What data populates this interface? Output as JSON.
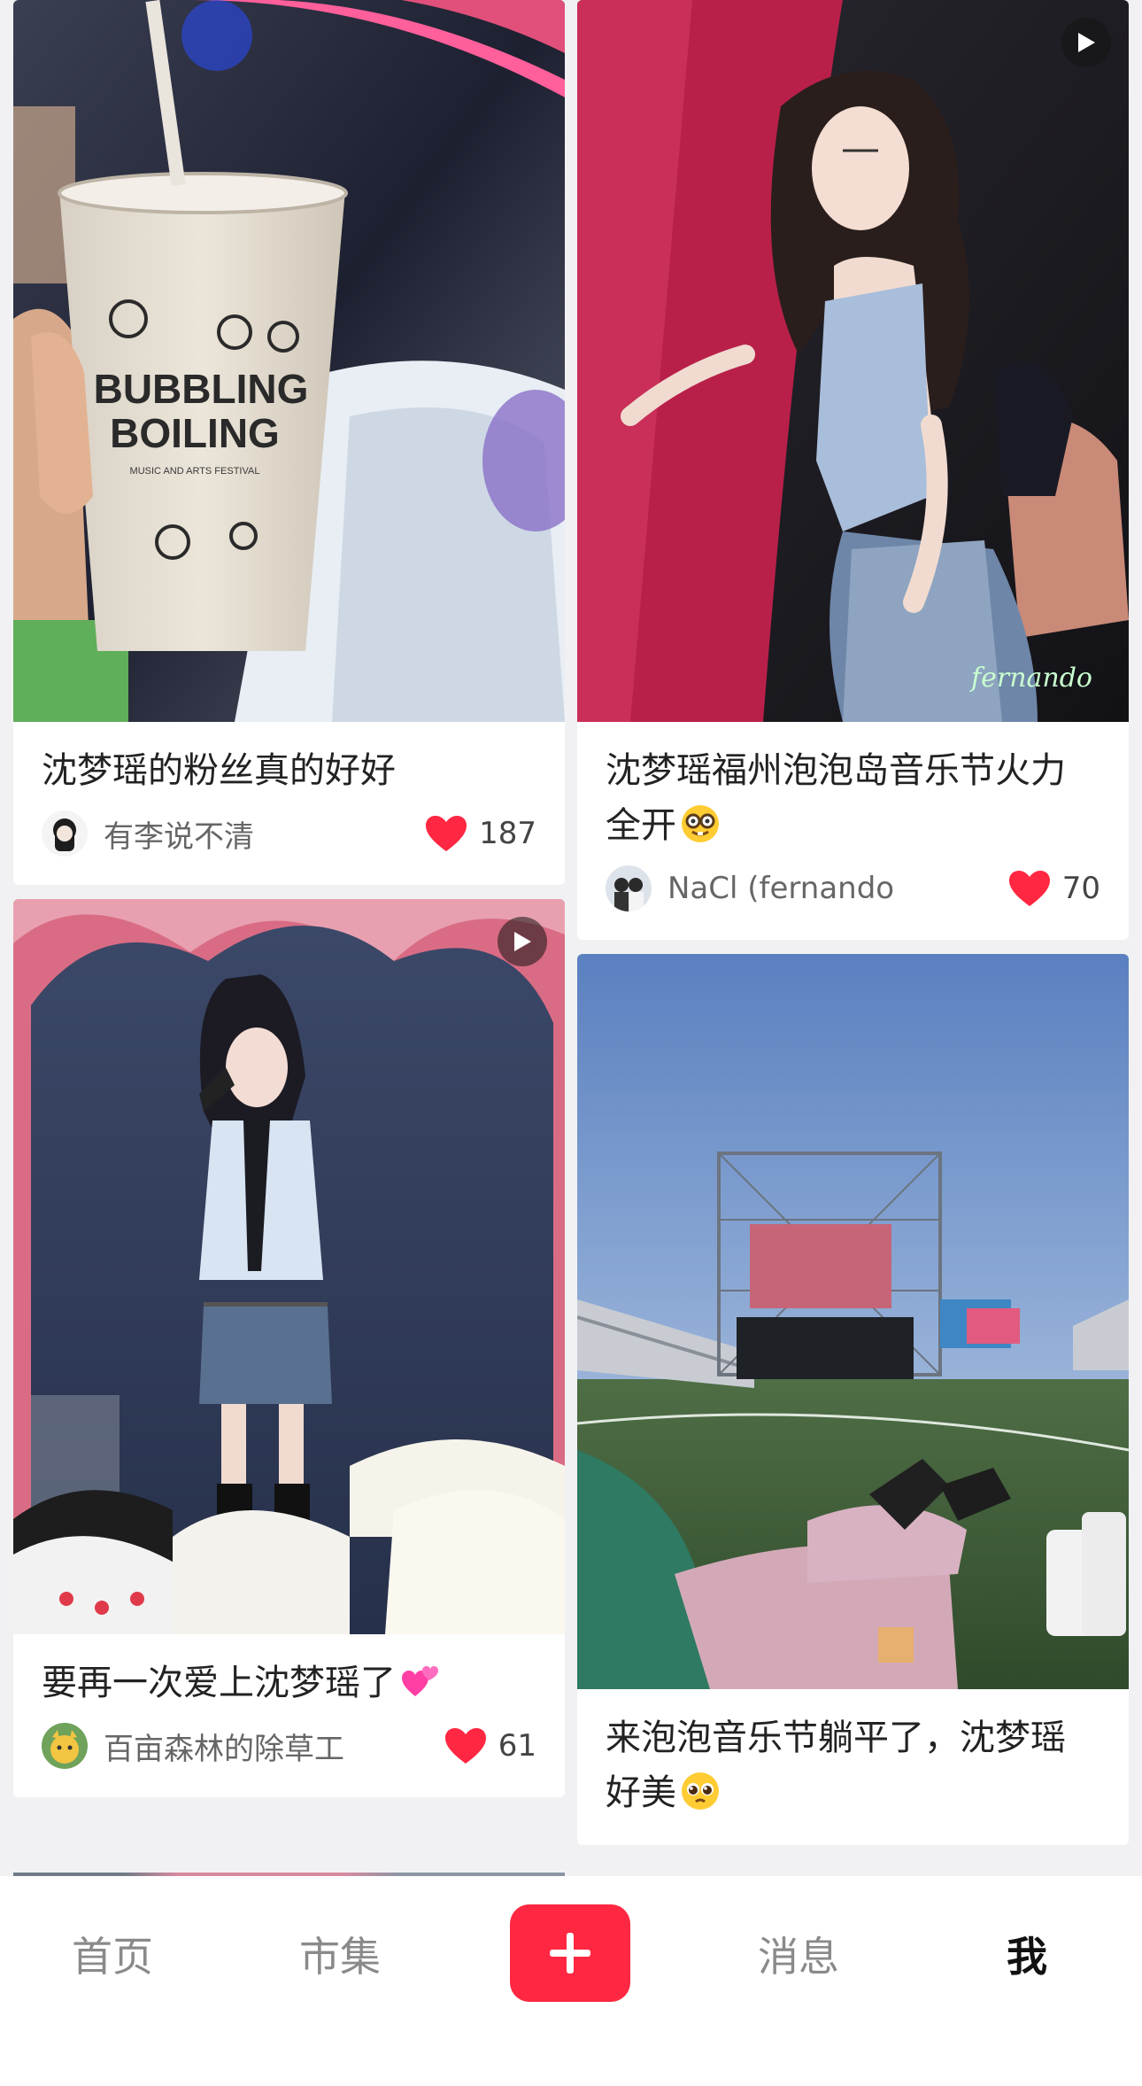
{
  "feed": {
    "left": [
      {
        "title": "沈梦瑶的粉丝真的好好",
        "author": "有李说不清",
        "likes": "187",
        "is_video": false,
        "image_text": [
          "BUBBLING",
          "BOILING",
          "MUSIC AND ARTS FESTIVAL"
        ]
      },
      {
        "title": "要再一次爱上沈梦瑶了",
        "title_emoji": "two-hearts",
        "author": "百亩森林的除草工",
        "likes": "61",
        "is_video": true
      }
    ],
    "right": [
      {
        "title": "沈梦瑶福州泡泡岛音乐节火力全开",
        "title_emoji": "nerd-face",
        "author": "NaCl (fernando",
        "likes": "70",
        "is_video": true,
        "watermark": "fernando"
      },
      {
        "title": "来泡泡音乐节躺平了，沈梦瑶好美",
        "title_emoji": "pleading-face",
        "is_video": false
      }
    ]
  },
  "tabbar": {
    "home": "首页",
    "market": "市集",
    "messages": "消息",
    "me": "我",
    "active": "me"
  },
  "colors": {
    "accent": "#ff2741",
    "like_heart": "#ff2741",
    "background": "#f1f1f3"
  }
}
